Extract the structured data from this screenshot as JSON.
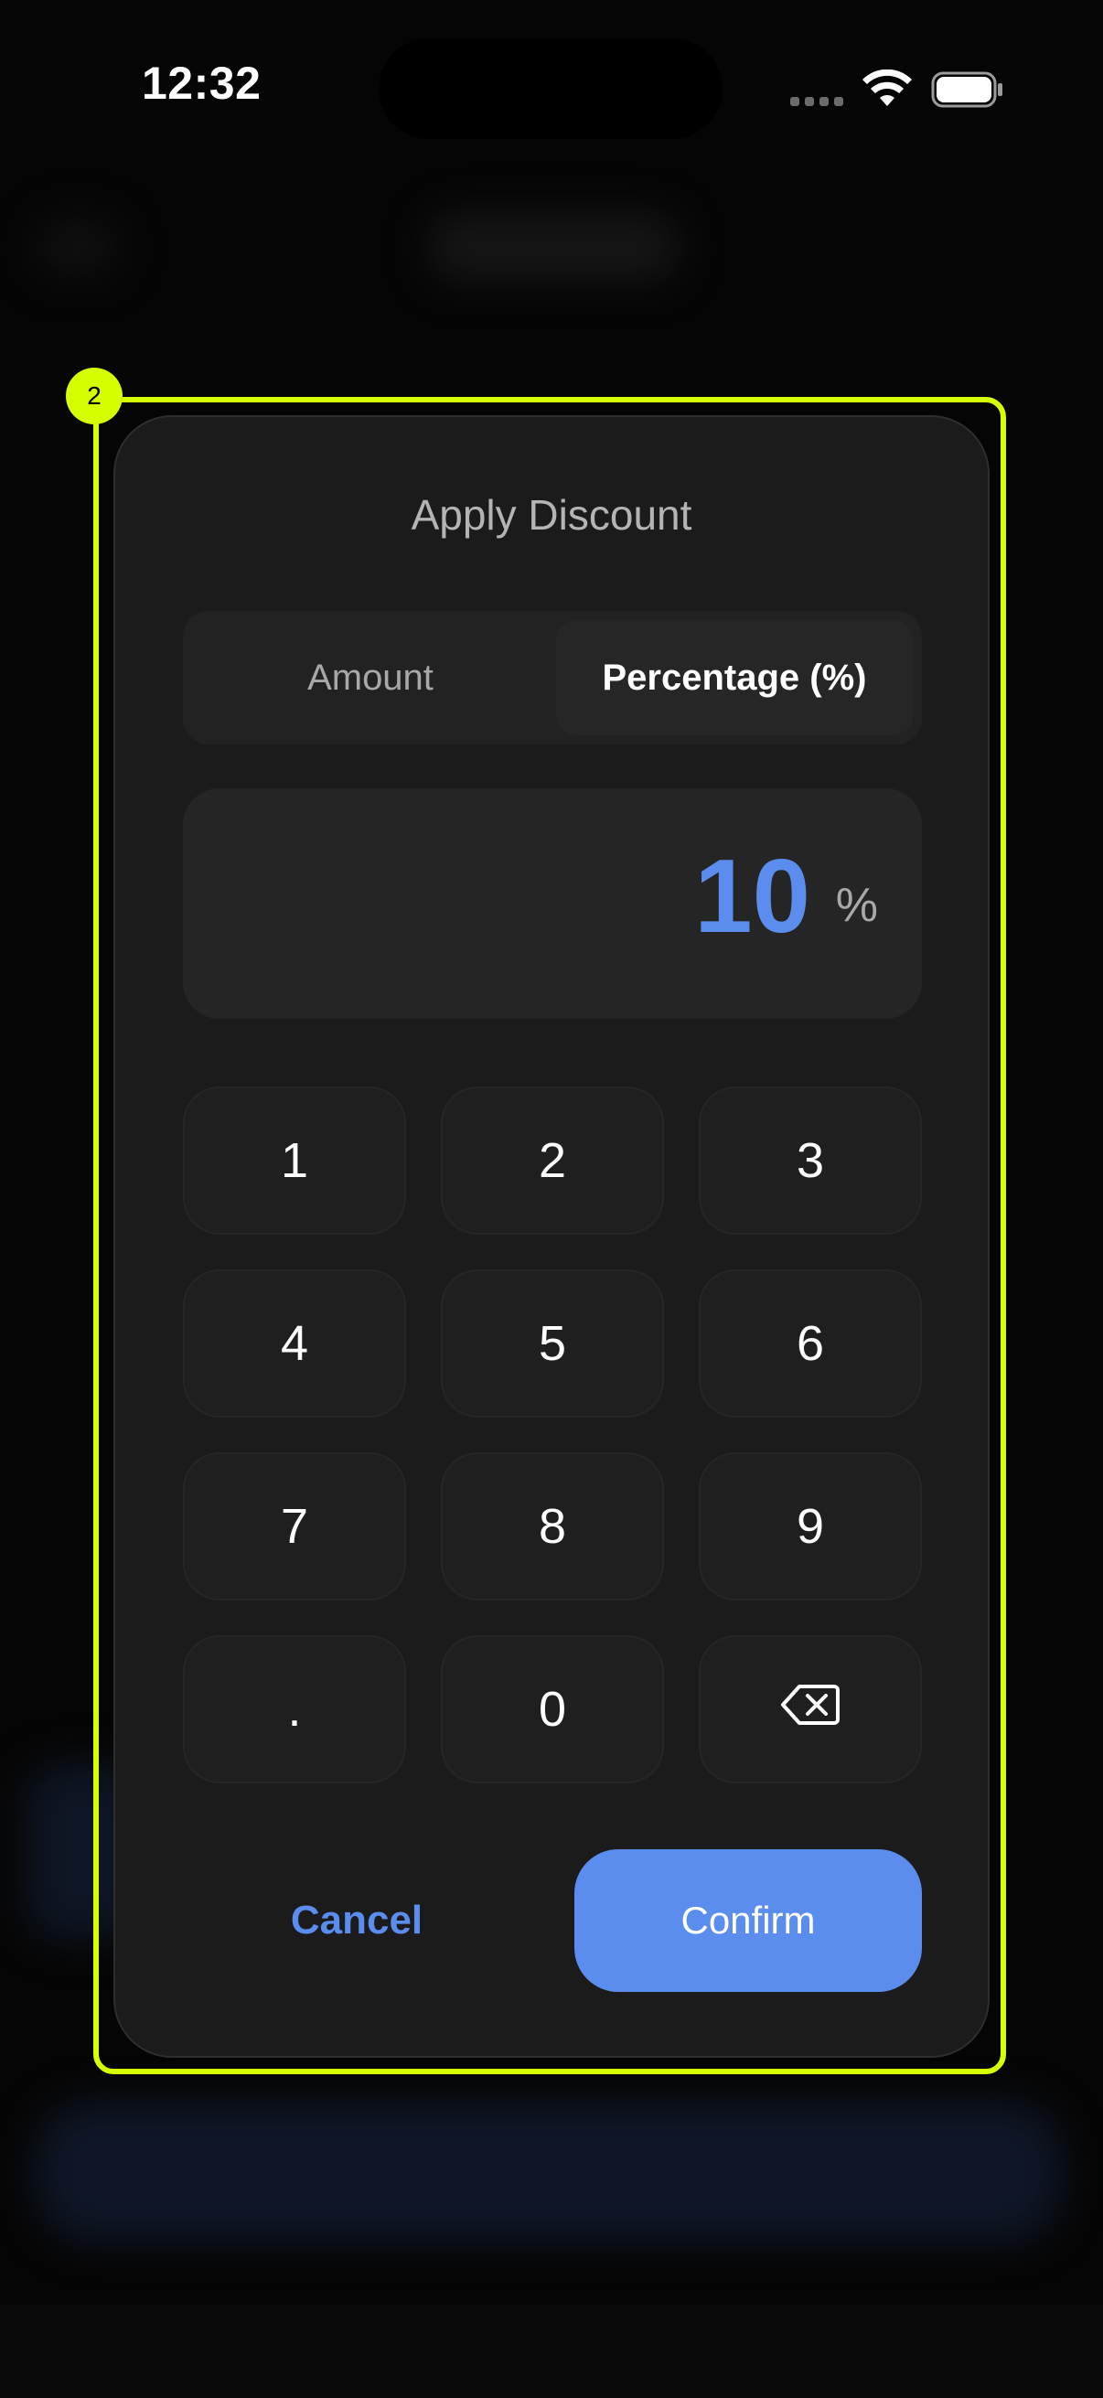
{
  "status_bar": {
    "time": "12:32"
  },
  "highlight": {
    "badge": "2",
    "color": "#d6ff00"
  },
  "dialog": {
    "title": "Apply Discount",
    "segments": [
      {
        "label": "Amount",
        "selected": false
      },
      {
        "label": "Percentage (%)",
        "selected": true
      }
    ],
    "display": {
      "value": "10",
      "unit": "%",
      "value_color": "#5b8def"
    },
    "keypad": [
      "1",
      "2",
      "3",
      "4",
      "5",
      "6",
      "7",
      "8",
      "9",
      ".",
      "0",
      "backspace-icon"
    ],
    "cancel_label": "Cancel",
    "confirm_label": "Confirm",
    "accent_color": "#5b8def"
  }
}
